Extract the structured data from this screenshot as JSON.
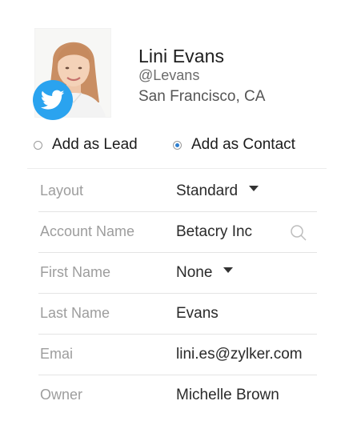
{
  "profile": {
    "name": "Lini Evans",
    "handle": "@Levans",
    "location": "San Francisco, CA",
    "badge_icon": "twitter-icon",
    "badge_color": "#2aa3ef"
  },
  "import_options": [
    {
      "label": "Add as Lead",
      "selected": false
    },
    {
      "label": "Add as Contact",
      "selected": true
    }
  ],
  "fields": [
    {
      "label": "Layout",
      "value": "Standard",
      "control": "dropdown"
    },
    {
      "label": "Account Name",
      "value": "Betacry Inc",
      "control": "lookup"
    },
    {
      "label": "First Name",
      "value": "None",
      "control": "dropdown"
    },
    {
      "label": "Last Name",
      "value": "Evans",
      "control": "text"
    },
    {
      "label": "Emai",
      "value": "lini.es@zylker.com",
      "control": "text"
    },
    {
      "label": "Owner",
      "value": "Michelle Brown",
      "control": "text"
    }
  ],
  "colors": {
    "accent": "#2e7fd0",
    "label_gray": "#9d9d9d",
    "divider": "#e4e4e4"
  }
}
